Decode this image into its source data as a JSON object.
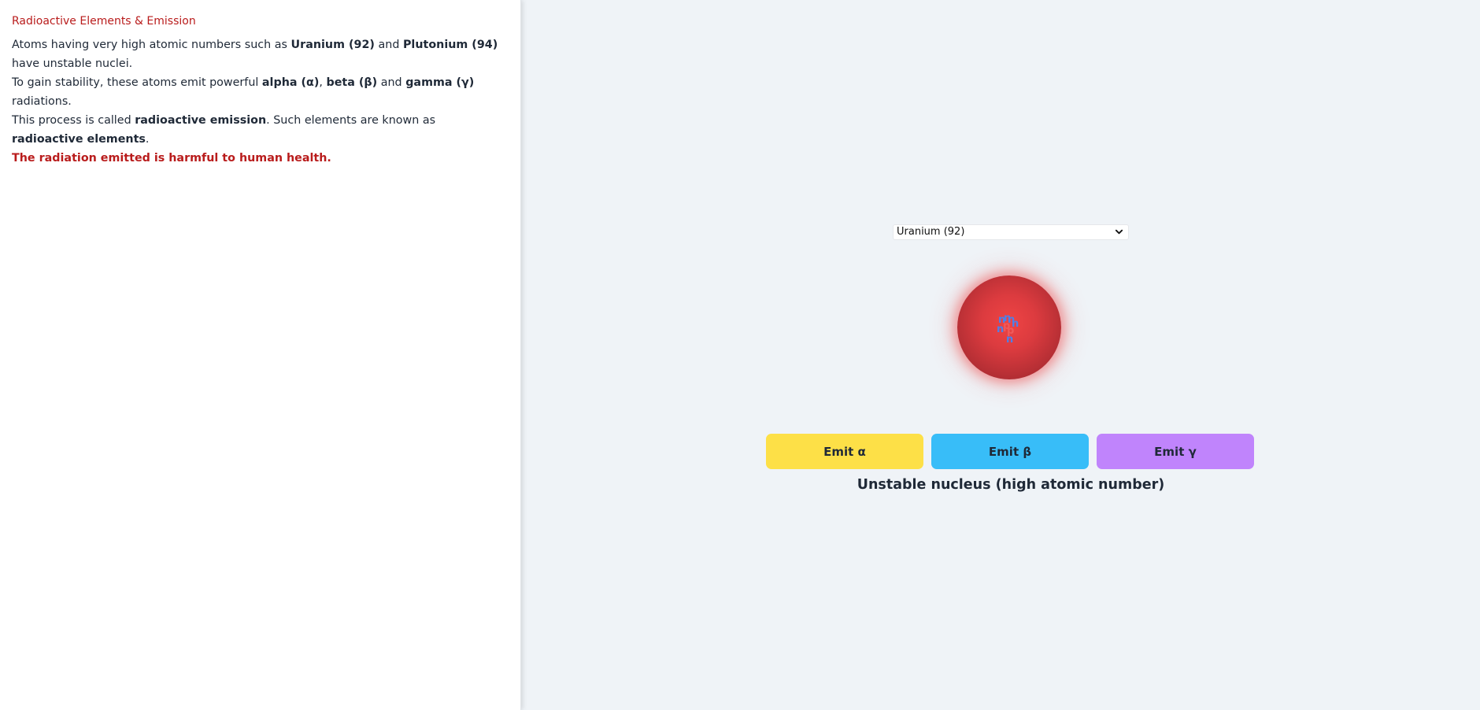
{
  "sidebar": {
    "title": "Radioactive Elements & Emission",
    "para1": {
      "t1": "Atoms having very high atomic numbers such as ",
      "b1": "Uranium (92)",
      "t2": " and ",
      "b2": "Plutonium (94)",
      "t3": " have unstable nuclei."
    },
    "para2": {
      "t1": "To gain stability, these atoms emit powerful ",
      "b1": "alpha (α)",
      "t2": ", ",
      "b2": "beta (β)",
      "t3": " and ",
      "b3": "gamma (γ)",
      "t4": " radiations."
    },
    "para3": {
      "t1": "This process is called ",
      "b1": "radioactive emission",
      "t2": ". Such elements are known as ",
      "b2": "radioactive elements",
      "t3": "."
    },
    "warning": "The radiation emitted is harmful to human health."
  },
  "simulator": {
    "element_select": {
      "selected": "Uranium (92)"
    },
    "nucleus": {
      "neutron_label": "n",
      "proton_label": "p"
    },
    "buttons": {
      "alpha": "Emit α",
      "beta": "Emit β",
      "gamma": "Emit γ"
    },
    "status": "Unstable nucleus (high atomic number)"
  },
  "colors": {
    "accent_red": "#b91c1c",
    "alpha_button": "#fde047",
    "beta_button": "#38bdf8",
    "gamma_button": "#c084fc",
    "nucleus": "#dc3b3f"
  }
}
